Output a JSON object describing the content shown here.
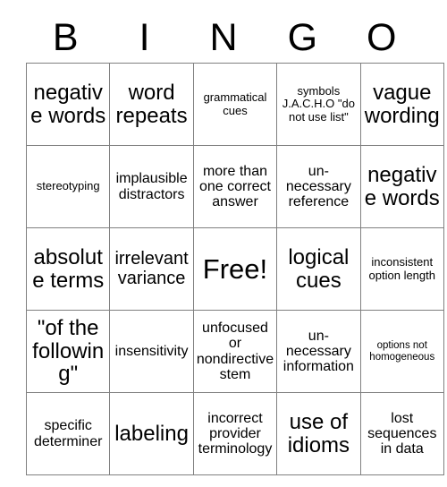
{
  "card": {
    "title_letters": [
      "B",
      "I",
      "N",
      "G",
      "O"
    ],
    "columns": 5,
    "rows": 5,
    "grid_line_color": "#808080",
    "background_color": "#ffffff",
    "text_color": "#000000",
    "free_space": {
      "row": 2,
      "col": 2,
      "label": "Free!"
    },
    "cells": [
      [
        {
          "text": "negative words",
          "size": "fs-xl"
        },
        {
          "text": "word repeats",
          "size": "fs-xl"
        },
        {
          "text": "grammatical cues",
          "size": "fs-s"
        },
        {
          "text": "symbols J.A.C.H.O \"do not use list\"",
          "size": "fs-s"
        },
        {
          "text": "vague wording",
          "size": "fs-xl"
        }
      ],
      [
        {
          "text": "stereotyping",
          "size": "fs-s"
        },
        {
          "text": "implausible distractors",
          "size": "fs-m"
        },
        {
          "text": "more than one correct answer",
          "size": "fs-m"
        },
        {
          "text": "un-necessary reference",
          "size": "fs-m"
        },
        {
          "text": "negative words",
          "size": "fs-xl"
        }
      ],
      [
        {
          "text": "absolute terms",
          "size": "fs-xl"
        },
        {
          "text": "irrelevant variance",
          "size": "fs-l"
        },
        {
          "text": "Free!",
          "size": "fs-xxl"
        },
        {
          "text": "logical cues",
          "size": "fs-xl"
        },
        {
          "text": "inconsistent option length",
          "size": "fs-s"
        }
      ],
      [
        {
          "text": "\"of the following\"",
          "size": "fs-xl"
        },
        {
          "text": "insensitivity",
          "size": "fs-m"
        },
        {
          "text": "unfocused or nondirective stem",
          "size": "fs-m"
        },
        {
          "text": "un-necessary information",
          "size": "fs-m"
        },
        {
          "text": "options not homogeneous",
          "size": "fs-xs"
        }
      ],
      [
        {
          "text": "specific determiner",
          "size": "fs-m"
        },
        {
          "text": "labeling",
          "size": "fs-xl"
        },
        {
          "text": "incorrect provider terminology",
          "size": "fs-m"
        },
        {
          "text": "use of idioms",
          "size": "fs-xl"
        },
        {
          "text": "lost sequences in data",
          "size": "fs-m"
        }
      ]
    ]
  }
}
